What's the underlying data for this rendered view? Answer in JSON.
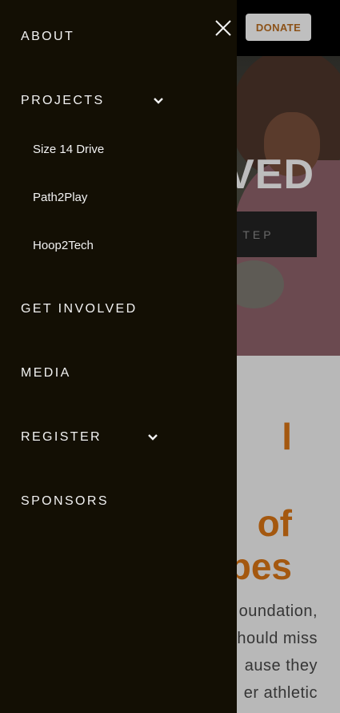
{
  "header": {
    "donate_label": "DONATE"
  },
  "hero": {
    "title_fragment": "VED",
    "cta_fragment": "TEP"
  },
  "mission": {
    "heading_lines": "l\n\nof\npes",
    "body_lines": "oundation,\nhould miss\nause they\ner athletic"
  },
  "drawer": {
    "close_icon": "close-icon",
    "items": [
      {
        "label": "ABOUT"
      },
      {
        "label": "PROJECTS",
        "icon": "chevron-down-icon",
        "children": [
          {
            "label": "Size 14 Drive"
          },
          {
            "label": "Path2Play"
          },
          {
            "label": "Hoop2Tech"
          }
        ]
      },
      {
        "label": "GET INVOLVED"
      },
      {
        "label": "MEDIA"
      },
      {
        "label": "REGISTER",
        "icon": "chevron-down-icon"
      },
      {
        "label": "SPONSORS"
      }
    ]
  },
  "colors": {
    "drawer_bg": "#130f04",
    "accent_orange": "#a4580f",
    "donate_bg": "#bfbfbf",
    "text_light": "#f2f2f2"
  }
}
